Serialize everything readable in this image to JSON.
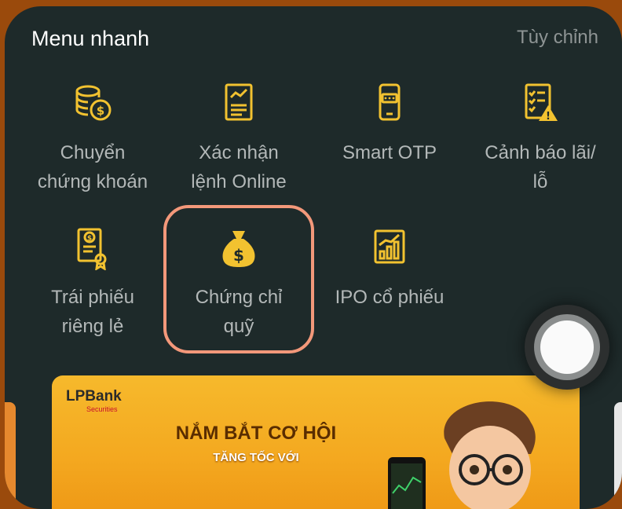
{
  "header": {
    "title": "Menu nhanh",
    "customize": "Tùy chỉnh"
  },
  "items": [
    {
      "label": "Chuyển\nchứng khoán",
      "icon": "coins-transfer-icon"
    },
    {
      "label": "Xác nhận\nlệnh Online",
      "icon": "document-chart-icon"
    },
    {
      "label": "Smart OTP",
      "icon": "phone-otp-icon"
    },
    {
      "label": "Cảnh báo lãi/\nlỗ",
      "icon": "checklist-warning-icon"
    },
    {
      "label": "Trái phiếu\nriêng lẻ",
      "icon": "bond-certificate-icon"
    },
    {
      "label": "Chứng chỉ\nquỹ",
      "icon": "money-bag-icon"
    },
    {
      "label": "IPO cổ phiếu",
      "icon": "growth-chart-icon"
    }
  ],
  "banner": {
    "logo": "LPBank",
    "logo_sub": "Securities",
    "headline": "NẮM BẮT CƠ HỘI",
    "subline": "TĂNG TỐC VỚI"
  },
  "colors": {
    "icon": "#f2c230",
    "highlight": "#f3987a",
    "panel": "#1e2a2a",
    "frame": "#9a4a0c"
  }
}
